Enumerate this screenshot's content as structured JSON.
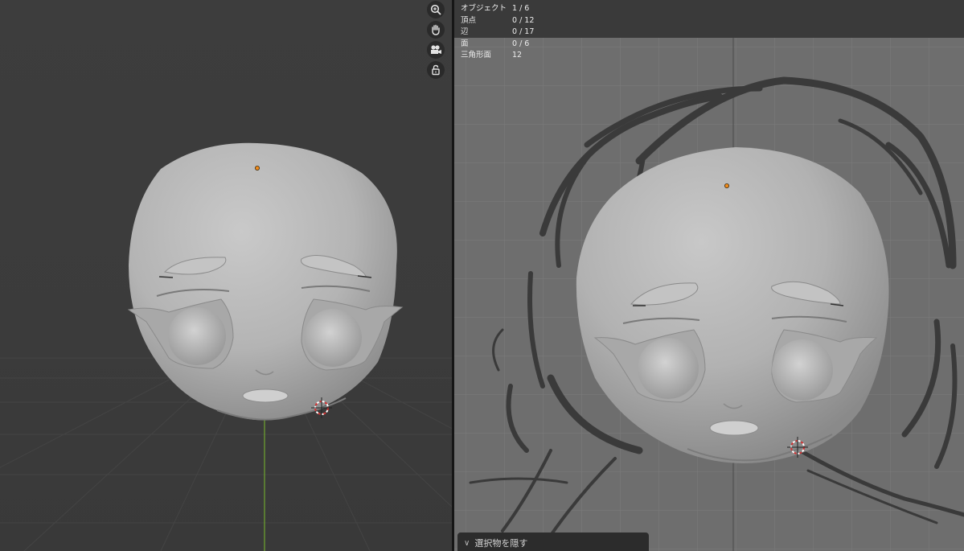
{
  "stats": [
    {
      "label": "オブジェクト",
      "value": "1 / 6"
    },
    {
      "label": "頂点",
      "value": "0 / 12"
    },
    {
      "label": "辺",
      "value": "0 / 17"
    },
    {
      "label": "面",
      "value": "0 / 6"
    },
    {
      "label": "三角形面",
      "value": "12"
    }
  ],
  "panel": {
    "hide_selected_label": "選択物を隠す"
  },
  "nav_icons": [
    "zoom-icon",
    "hand-pan-icon",
    "camera-icon",
    "lock-icon"
  ],
  "colors": {
    "origin_dot": "#f08a1a",
    "axis_green": "#6fa52f",
    "cursor_red": "#d23232",
    "model_gray": "#bdbdbd"
  }
}
